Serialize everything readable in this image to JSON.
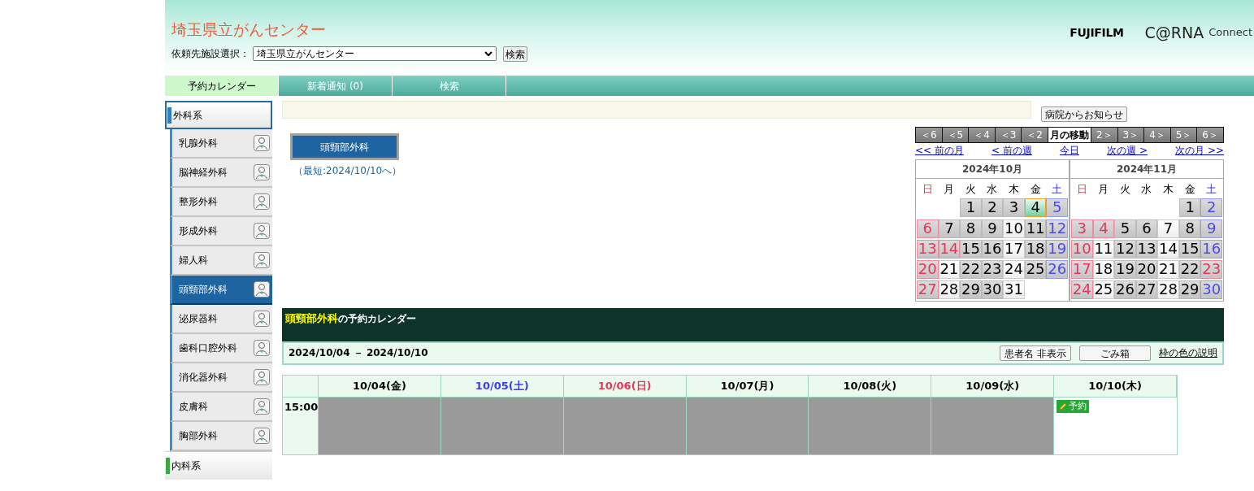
{
  "header": {
    "title": "埼玉県立がんセンター",
    "facility_label": "依頼先施設選択：",
    "facility_value": "埼玉県立がんセンター",
    "search_button": "検索",
    "brand": "FUJIFILM",
    "product": "C@RNA",
    "product_suffix": "Connect"
  },
  "nav_tabs": [
    {
      "label": "予約カレンダー",
      "selected": true
    },
    {
      "label": "新着通知 (0)",
      "selected": false
    },
    {
      "label": "検索",
      "selected": false
    }
  ],
  "sidebar": [
    {
      "label": "外科系",
      "expanded": true,
      "color": "#2f7fc0",
      "children": [
        {
          "label": "乳腺外科",
          "selected": false
        },
        {
          "label": "脳神経外科",
          "selected": false
        },
        {
          "label": "整形外科",
          "selected": false
        },
        {
          "label": "形成外科",
          "selected": false
        },
        {
          "label": "婦人科",
          "selected": false
        },
        {
          "label": "頭頸部外科",
          "selected": true
        },
        {
          "label": "泌尿器科",
          "selected": false
        },
        {
          "label": "歯科口腔外科",
          "selected": false
        },
        {
          "label": "消化器外科",
          "selected": false
        },
        {
          "label": "皮膚科",
          "selected": false
        },
        {
          "label": "胸部外科",
          "selected": false
        }
      ]
    },
    {
      "label": "内科系",
      "expanded": false,
      "color": "#3aa845"
    }
  ],
  "notice_button": "病院からお知らせ",
  "department": {
    "button": "頭頸部外科",
    "earliest": "（最短:2024/10/10へ）"
  },
  "month_nav": [
    {
      "label": "＜6",
      "kind": "step"
    },
    {
      "label": "＜5",
      "kind": "step"
    },
    {
      "label": "＜4",
      "kind": "step"
    },
    {
      "label": "＜3",
      "kind": "step"
    },
    {
      "label": "＜2",
      "kind": "step"
    },
    {
      "label": "月の移動",
      "kind": "title"
    },
    {
      "label": "2＞",
      "kind": "step"
    },
    {
      "label": "3＞",
      "kind": "step"
    },
    {
      "label": "4＞",
      "kind": "step"
    },
    {
      "label": "5＞",
      "kind": "step"
    },
    {
      "label": "6＞",
      "kind": "step"
    }
  ],
  "week_links": [
    "<< 前の月",
    "< 前の週",
    "今日",
    "次の週 >",
    "次の月 >>"
  ],
  "months": [
    {
      "title": "2024年10月",
      "weekdays": [
        {
          "label": "日",
          "kind": "sunday"
        },
        {
          "label": "月",
          "kind": "weekday"
        },
        {
          "label": "火",
          "kind": "weekday"
        },
        {
          "label": "水",
          "kind": "weekday"
        },
        {
          "label": "木",
          "kind": "weekday"
        },
        {
          "label": "金",
          "kind": "weekday"
        },
        {
          "label": "土",
          "kind": "saturday"
        }
      ],
      "weeks": [
        [
          {
            "kind": "blank"
          },
          {
            "kind": "blank"
          },
          {
            "d": "1",
            "kind": "gray",
            "selected": false
          },
          {
            "d": "2",
            "kind": "gray",
            "selected": false
          },
          {
            "d": "3",
            "kind": "gray",
            "selected": false
          },
          {
            "d": "4",
            "kind": "gray",
            "selected": true
          },
          {
            "d": "5",
            "kind": "saturday",
            "selected": false
          }
        ],
        [
          {
            "d": "6",
            "kind": "holiday",
            "selected": false
          },
          {
            "d": "7",
            "kind": "gray",
            "selected": false
          },
          {
            "d": "8",
            "kind": "gray",
            "selected": false
          },
          {
            "d": "9",
            "kind": "gray",
            "selected": false
          },
          {
            "d": "10",
            "kind": "white",
            "selected": false
          },
          {
            "d": "11",
            "kind": "gray",
            "selected": false
          },
          {
            "d": "12",
            "kind": "saturday",
            "selected": false
          }
        ],
        [
          {
            "d": "13",
            "kind": "holiday",
            "selected": false
          },
          {
            "d": "14",
            "kind": "holiday",
            "selected": false
          },
          {
            "d": "15",
            "kind": "gray",
            "selected": false
          },
          {
            "d": "16",
            "kind": "gray",
            "selected": false
          },
          {
            "d": "17",
            "kind": "white",
            "selected": false
          },
          {
            "d": "18",
            "kind": "gray",
            "selected": false
          },
          {
            "d": "19",
            "kind": "saturday",
            "selected": false
          }
        ],
        [
          {
            "d": "20",
            "kind": "holiday",
            "selected": false
          },
          {
            "d": "21",
            "kind": "white",
            "selected": false
          },
          {
            "d": "22",
            "kind": "gray",
            "selected": false
          },
          {
            "d": "23",
            "kind": "gray",
            "selected": false
          },
          {
            "d": "24",
            "kind": "white",
            "selected": false
          },
          {
            "d": "25",
            "kind": "gray",
            "selected": false
          },
          {
            "d": "26",
            "kind": "saturday",
            "selected": false
          }
        ],
        [
          {
            "d": "27",
            "kind": "holiday",
            "selected": false
          },
          {
            "d": "28",
            "kind": "white",
            "selected": false
          },
          {
            "d": "29",
            "kind": "gray",
            "selected": false
          },
          {
            "d": "30",
            "kind": "gray",
            "selected": false
          },
          {
            "d": "31",
            "kind": "white",
            "selected": false
          },
          {
            "kind": "blank"
          },
          {
            "kind": "blank"
          }
        ]
      ]
    },
    {
      "title": "2024年11月",
      "weekdays": [
        {
          "label": "日",
          "kind": "sunday"
        },
        {
          "label": "月",
          "kind": "weekday"
        },
        {
          "label": "火",
          "kind": "weekday"
        },
        {
          "label": "水",
          "kind": "weekday"
        },
        {
          "label": "木",
          "kind": "weekday"
        },
        {
          "label": "金",
          "kind": "weekday"
        },
        {
          "label": "土",
          "kind": "saturday"
        }
      ],
      "weeks": [
        [
          {
            "kind": "blank"
          },
          {
            "kind": "blank"
          },
          {
            "kind": "blank"
          },
          {
            "kind": "blank"
          },
          {
            "kind": "blank"
          },
          {
            "d": "1",
            "kind": "gray",
            "selected": false
          },
          {
            "d": "2",
            "kind": "saturday",
            "selected": false
          }
        ],
        [
          {
            "d": "3",
            "kind": "holiday",
            "selected": false
          },
          {
            "d": "4",
            "kind": "holiday",
            "selected": false
          },
          {
            "d": "5",
            "kind": "gray",
            "selected": false
          },
          {
            "d": "6",
            "kind": "gray",
            "selected": false
          },
          {
            "d": "7",
            "kind": "white",
            "selected": false
          },
          {
            "d": "8",
            "kind": "gray",
            "selected": false
          },
          {
            "d": "9",
            "kind": "saturday",
            "selected": false
          }
        ],
        [
          {
            "d": "10",
            "kind": "holiday",
            "selected": false
          },
          {
            "d": "11",
            "kind": "white",
            "selected": false
          },
          {
            "d": "12",
            "kind": "gray",
            "selected": false
          },
          {
            "d": "13",
            "kind": "gray",
            "selected": false
          },
          {
            "d": "14",
            "kind": "white",
            "selected": false
          },
          {
            "d": "15",
            "kind": "gray",
            "selected": false
          },
          {
            "d": "16",
            "kind": "saturday",
            "selected": false
          }
        ],
        [
          {
            "d": "17",
            "kind": "holiday",
            "selected": false
          },
          {
            "d": "18",
            "kind": "white",
            "selected": false
          },
          {
            "d": "19",
            "kind": "gray",
            "selected": false
          },
          {
            "d": "20",
            "kind": "gray",
            "selected": false
          },
          {
            "d": "21",
            "kind": "white",
            "selected": false
          },
          {
            "d": "22",
            "kind": "gray",
            "selected": false
          },
          {
            "d": "23",
            "kind": "holiday",
            "selected": false
          }
        ],
        [
          {
            "d": "24",
            "kind": "holiday",
            "selected": false
          },
          {
            "d": "25",
            "kind": "white",
            "selected": false
          },
          {
            "d": "26",
            "kind": "gray",
            "selected": false
          },
          {
            "d": "27",
            "kind": "gray",
            "selected": false
          },
          {
            "d": "28",
            "kind": "white",
            "selected": false
          },
          {
            "d": "29",
            "kind": "gray",
            "selected": false
          },
          {
            "d": "30",
            "kind": "saturday",
            "selected": false
          }
        ]
      ]
    }
  ],
  "schedule": {
    "title_highlight": "頭頸部外科",
    "title_rest": "の予約カレンダー",
    "range": "2024/10/04 － 2024/10/10",
    "buttons": [
      "患者名 非表示",
      "ごみ箱"
    ],
    "legend_link": "枠の色の説明",
    "columns": [
      {
        "label": "10/04(金)",
        "kind": "weekday"
      },
      {
        "label": "10/05(土)",
        "kind": "saturday"
      },
      {
        "label": "10/06(日)",
        "kind": "sunday"
      },
      {
        "label": "10/07(月)",
        "kind": "weekday"
      },
      {
        "label": "10/08(火)",
        "kind": "weekday"
      },
      {
        "label": "10/09(水)",
        "kind": "weekday"
      },
      {
        "label": "10/10(木)",
        "kind": "weekday"
      }
    ],
    "rows": [
      {
        "time": "15:00",
        "cells": [
          {
            "kind": "closed"
          },
          {
            "kind": "closed"
          },
          {
            "kind": "closed"
          },
          {
            "kind": "closed"
          },
          {
            "kind": "closed"
          },
          {
            "kind": "closed"
          },
          {
            "kind": "open",
            "label": "予約"
          }
        ]
      }
    ]
  }
}
